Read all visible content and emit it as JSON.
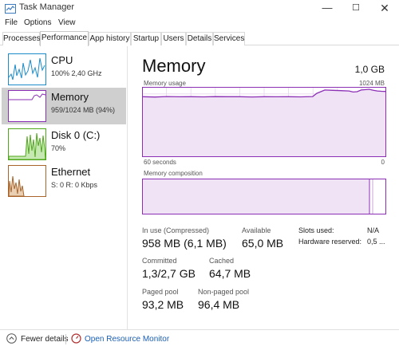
{
  "window": {
    "title": "Task Manager",
    "min": "—",
    "max": "☐",
    "close": "✕"
  },
  "menu": [
    "File",
    "Options",
    "View"
  ],
  "tabs": [
    "Processes",
    "Performance",
    "App history",
    "Startup",
    "Users",
    "Details",
    "Services"
  ],
  "active_tab": "Performance",
  "sidebar": [
    {
      "name": "CPU",
      "sub": "100% 2,40 GHz",
      "color": "#1b8bc9"
    },
    {
      "name": "Memory",
      "sub": "959/1024 MB (94%)",
      "color": "#8b2fb5"
    },
    {
      "name": "Disk 0 (C:)",
      "sub": "70%",
      "color": "#4fa81a"
    },
    {
      "name": "Ethernet",
      "sub": "S: 0 R: 0 Kbps",
      "color": "#a8642a"
    }
  ],
  "main": {
    "title": "Memory",
    "total": "1,0 GB",
    "usage_label": "Memory usage",
    "usage_max": "1024 MB",
    "time_left": "60 seconds",
    "time_right": "0",
    "composition_label": "Memory composition",
    "accent": "#8b2fb5"
  },
  "stats": {
    "in_use_label": "In use (Compressed)",
    "in_use_value": "958 MB (6,1 MB)",
    "available_label": "Available",
    "available_value": "65,0 MB",
    "slots_label": "Slots used:",
    "slots_value": "N/A",
    "hw_label": "Hardware reserved:",
    "hw_value": "0,5 ...",
    "committed_label": "Committed",
    "committed_value": "1,3/2,7 GB",
    "cached_label": "Cached",
    "cached_value": "64,7 MB",
    "paged_label": "Paged pool",
    "paged_value": "93,2 MB",
    "nonpaged_label": "Non-paged pool",
    "nonpaged_value": "96,4 MB"
  },
  "footer": {
    "fewer_details": "Fewer details",
    "resource_monitor": "Open Resource Monitor"
  },
  "chart_data": {
    "type": "line",
    "xlabel": "60 seconds",
    "ylabel": "Memory usage",
    "xlim": [
      60,
      0
    ],
    "ylim": [
      0,
      1024
    ],
    "grid": true,
    "series": [
      {
        "values": [
          [
            60,
            890
          ],
          [
            57,
            885
          ],
          [
            54,
            892
          ],
          [
            51,
            888
          ],
          [
            48,
            890
          ],
          [
            45,
            887
          ],
          [
            42,
            891
          ],
          [
            39,
            889
          ],
          [
            36,
            890
          ],
          [
            33,
            886
          ],
          [
            30,
            889
          ],
          [
            27,
            888
          ],
          [
            24,
            890
          ],
          [
            21,
            887
          ],
          [
            18,
            892
          ],
          [
            17,
            940
          ],
          [
            15,
            990
          ],
          [
            13,
            985
          ],
          [
            11,
            980
          ],
          [
            9,
            975
          ],
          [
            8,
            960
          ],
          [
            7,
            965
          ],
          [
            6,
            990
          ],
          [
            4,
            1000
          ],
          [
            3,
            985
          ],
          [
            2,
            975
          ],
          [
            1,
            970
          ],
          [
            0,
            968
          ]
        ]
      }
    ]
  }
}
